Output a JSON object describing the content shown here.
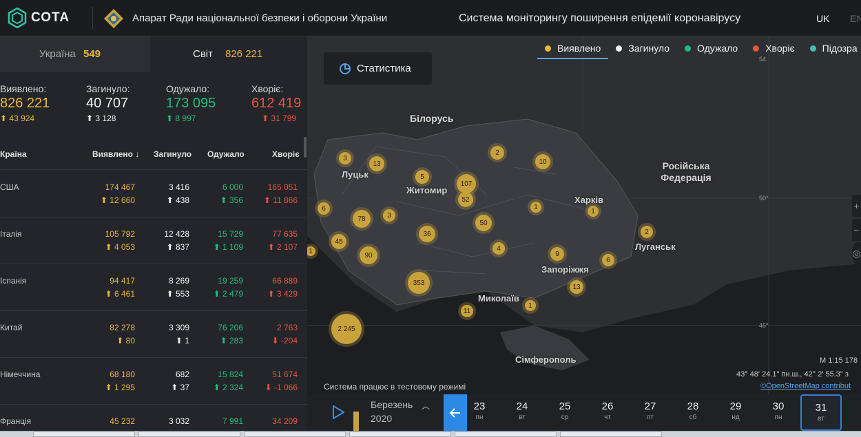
{
  "header": {
    "logo": "СОТА",
    "org": "Апарат Ради національної безпеки і оборони України",
    "system": "Система моніторингу поширення епідемії коронавірусу",
    "lang_uk": "UK",
    "lang_en": "EN"
  },
  "tabs": {
    "ukraine_label": "Україна",
    "ukraine_value": "549",
    "world_label": "Світ",
    "world_value": "826 221"
  },
  "stats": {
    "detected_label": "Виявлено:",
    "detected": "826 221",
    "detected_delta": "43 924",
    "died_label": "Загинуло:",
    "died": "40 707",
    "died_delta": "3 128",
    "recovered_label": "Одужало:",
    "recovered": "173 095",
    "recovered_delta": "8 997",
    "sick_label": "Хворіє:",
    "sick": "612 419",
    "sick_delta": "31 799"
  },
  "table": {
    "headers": [
      "Країна",
      "Виявлено",
      "Загинуло",
      "Одужало",
      "Хворіє"
    ],
    "rows": [
      {
        "country": "США",
        "detected": "174 467",
        "detected_delta": "12 660",
        "died": "3 416",
        "died_delta": "438",
        "recovered": "6 000",
        "recovered_delta": "356",
        "sick": "165 051",
        "sick_delta": "11 866",
        "sick_dir": "up"
      },
      {
        "country": "Італія",
        "detected": "105 792",
        "detected_delta": "4 053",
        "died": "12 428",
        "died_delta": "837",
        "recovered": "15 729",
        "recovered_delta": "1 109",
        "sick": "77 635",
        "sick_delta": "2 107",
        "sick_dir": "up"
      },
      {
        "country": "Іспанія",
        "detected": "94 417",
        "detected_delta": "6 461",
        "died": "8 269",
        "died_delta": "553",
        "recovered": "19 259",
        "recovered_delta": "2 479",
        "sick": "66 889",
        "sick_delta": "3 429",
        "sick_dir": "up"
      },
      {
        "country": "Китай",
        "detected": "82 278",
        "detected_delta": "80",
        "died": "3 309",
        "died_delta": "1",
        "recovered": "76 206",
        "recovered_delta": "283",
        "sick": "2 763",
        "sick_delta": "-204",
        "sick_dir": "down"
      },
      {
        "country": "Німеччина",
        "detected": "68 180",
        "detected_delta": "1 295",
        "died": "682",
        "died_delta": "37",
        "recovered": "15 824",
        "recovered_delta": "2 324",
        "sick": "51 674",
        "sick_delta": "-1 066",
        "sick_dir": "down"
      },
      {
        "country": "Франція",
        "detected": "45 232",
        "detected_delta": "",
        "died": "3 032",
        "died_delta": "",
        "recovered": "7 991",
        "recovered_delta": "",
        "sick": "34 209",
        "sick_delta": "",
        "sick_dir": "up"
      }
    ]
  },
  "legend": [
    {
      "label": "Виявлено",
      "color": "#e8b83a"
    },
    {
      "label": "Загинуло",
      "color": "#ffffff"
    },
    {
      "label": "Одужало",
      "color": "#1fbf7a"
    },
    {
      "label": "Хворіє",
      "color": "#e8533d"
    },
    {
      "label": "Підозра",
      "color": "#3cc0b0"
    }
  ],
  "map": {
    "stat_button": "Статистика",
    "clusters": [
      "3",
      "13",
      "2",
      "10",
      "5",
      "107",
      "52",
      "6",
      "78",
      "3",
      "36",
      "50",
      "1",
      "1",
      "2",
      "45",
      "90",
      "4",
      "9",
      "6",
      "1",
      "353",
      "13",
      "11",
      "1",
      "2 245"
    ],
    "cities": [
      "Луцьк",
      "Житомир",
      "Харків",
      "Луганськ",
      "Запоріжжя",
      "Миколаїв",
      "Сімферополь"
    ],
    "countries": [
      "Білорусь",
      "Російська Федерація"
    ],
    "lat_labels": [
      "54",
      "50°",
      "46°"
    ],
    "scale": "М 1:15 178",
    "coords": "43° 48' 24.1\" пн.ш., 42° 2' 55.3\" з",
    "osm": "©OpenStreetMap contribut",
    "test_mode": "Система працює в тестовому режимі"
  },
  "timeline": {
    "month": "Березень",
    "year": "2020",
    "progress": 0.97,
    "days": [
      {
        "n": "23",
        "w": "пн"
      },
      {
        "n": "24",
        "w": "вт"
      },
      {
        "n": "25",
        "w": "ср"
      },
      {
        "n": "26",
        "w": "чт"
      },
      {
        "n": "27",
        "w": "пт"
      },
      {
        "n": "28",
        "w": "сб"
      },
      {
        "n": "29",
        "w": "нд"
      },
      {
        "n": "30",
        "w": "пн"
      },
      {
        "n": "31",
        "w": "вт"
      }
    ],
    "selected": "31"
  },
  "colors": {
    "yellow": "#e8b83a",
    "green": "#1fbf7a",
    "red": "#e8533d",
    "blue": "#2d89e6"
  }
}
